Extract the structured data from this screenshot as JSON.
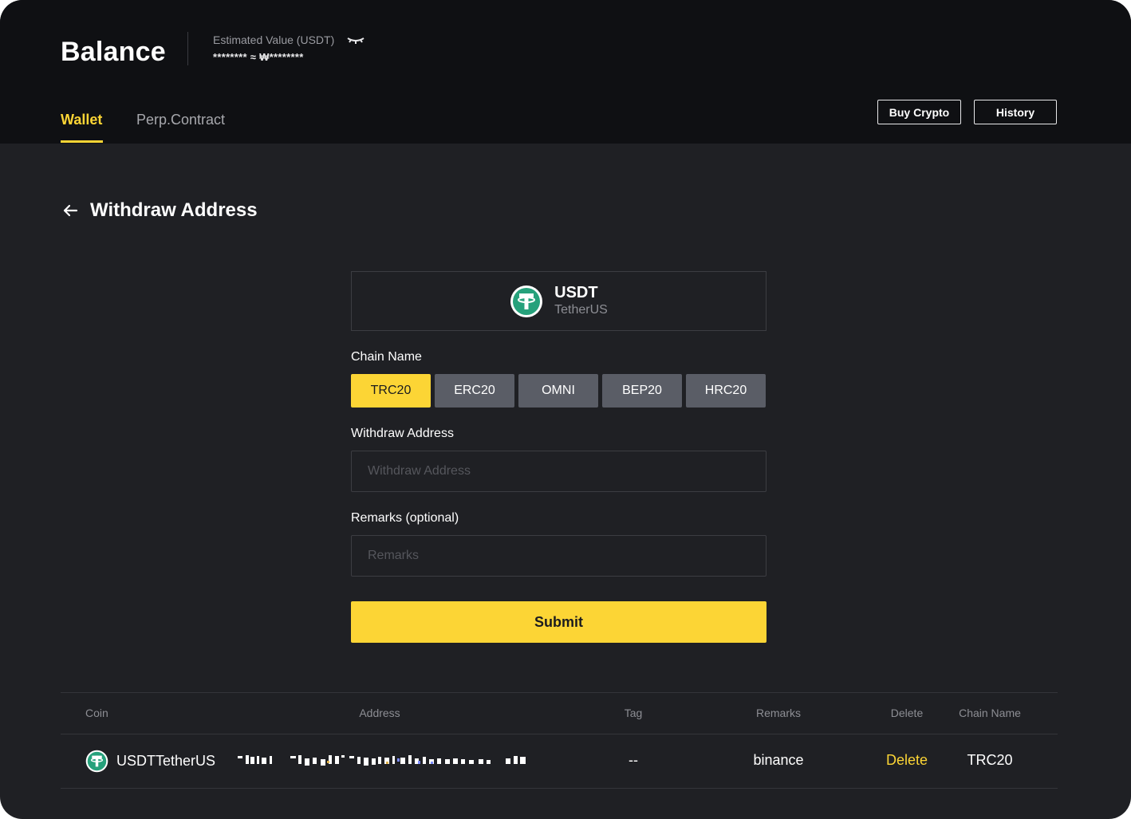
{
  "header": {
    "title": "Balance",
    "estimated_label": "Estimated Value (USDT)",
    "estimated_value": "******** ≈ ₩********",
    "tabs": [
      {
        "label": "Wallet",
        "active": true
      },
      {
        "label": "Perp.Contract",
        "active": false
      }
    ],
    "buy_crypto_label": "Buy Crypto",
    "history_label": "History"
  },
  "page": {
    "title": "Withdraw Address"
  },
  "coin": {
    "symbol": "USDT",
    "name": "TetherUS",
    "icon": "tether-icon",
    "color": "#26a17b"
  },
  "form": {
    "chain_label": "Chain Name",
    "chains": [
      {
        "label": "TRC20",
        "active": true
      },
      {
        "label": "ERC20",
        "active": false
      },
      {
        "label": "OMNI",
        "active": false
      },
      {
        "label": "BEP20",
        "active": false
      },
      {
        "label": "HRC20",
        "active": false
      }
    ],
    "address_label": "Withdraw Address",
    "address_placeholder": "Withdraw Address",
    "address_value": "",
    "remarks_label": "Remarks (optional)",
    "remarks_placeholder": "Remarks",
    "remarks_value": "",
    "submit_label": "Submit"
  },
  "table": {
    "columns": [
      "Coin",
      "Address",
      "Tag",
      "Remarks",
      "Delete",
      "Chain Name"
    ],
    "rows": [
      {
        "coin": "USDTTetherUS",
        "address": "(pixelated)",
        "tag": "--",
        "remarks": "binance",
        "delete": "Delete",
        "chain": "TRC20"
      }
    ]
  },
  "colors": {
    "accent": "#fcd535",
    "header_bg": "#0f1013",
    "page_bg": "#1f2024",
    "chain_inactive": "#5a5d66"
  }
}
